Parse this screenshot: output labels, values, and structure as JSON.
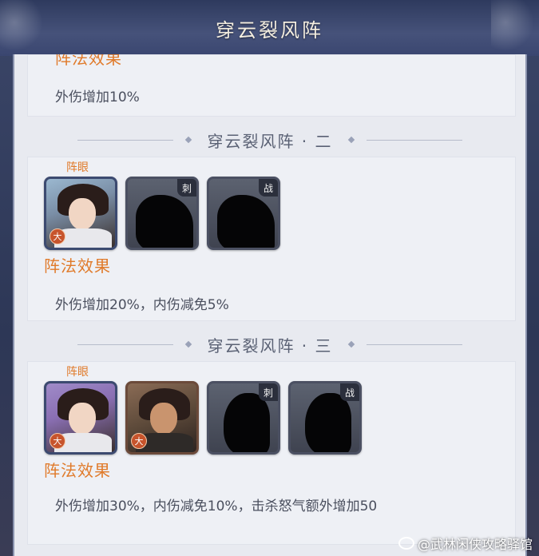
{
  "window": {
    "title": "穿云裂风阵"
  },
  "top_section": {
    "partial_effect_title": "阵法效果",
    "effect": "外伤增加10%"
  },
  "sections": [
    {
      "heading": "穿云裂风阵 · 二",
      "eye_label": "阵眼",
      "slots": [
        {
          "kind": "hero",
          "badge": "大"
        },
        {
          "kind": "locked",
          "tag": "刺"
        },
        {
          "kind": "locked",
          "tag": "战"
        }
      ],
      "effect_title": "阵法效果",
      "effect": "外伤增加20%，内伤减免5%"
    },
    {
      "heading": "穿云裂风阵 · 三",
      "eye_label": "阵眼",
      "slots": [
        {
          "kind": "hero",
          "badge": "大"
        },
        {
          "kind": "hero",
          "badge": "大"
        },
        {
          "kind": "locked",
          "tag": "刺"
        },
        {
          "kind": "locked",
          "tag": "战"
        }
      ],
      "effect_title": "阵法效果",
      "effect": "外伤增加30%，内伤减免10%，击杀怒气额外增加50"
    }
  ],
  "watermark": "@武林闲侠攻略驿馆",
  "colors": {
    "accent_orange": "#e07a2a",
    "panel_bg": "#e8eaf0",
    "header_bg": "#3b4668"
  }
}
